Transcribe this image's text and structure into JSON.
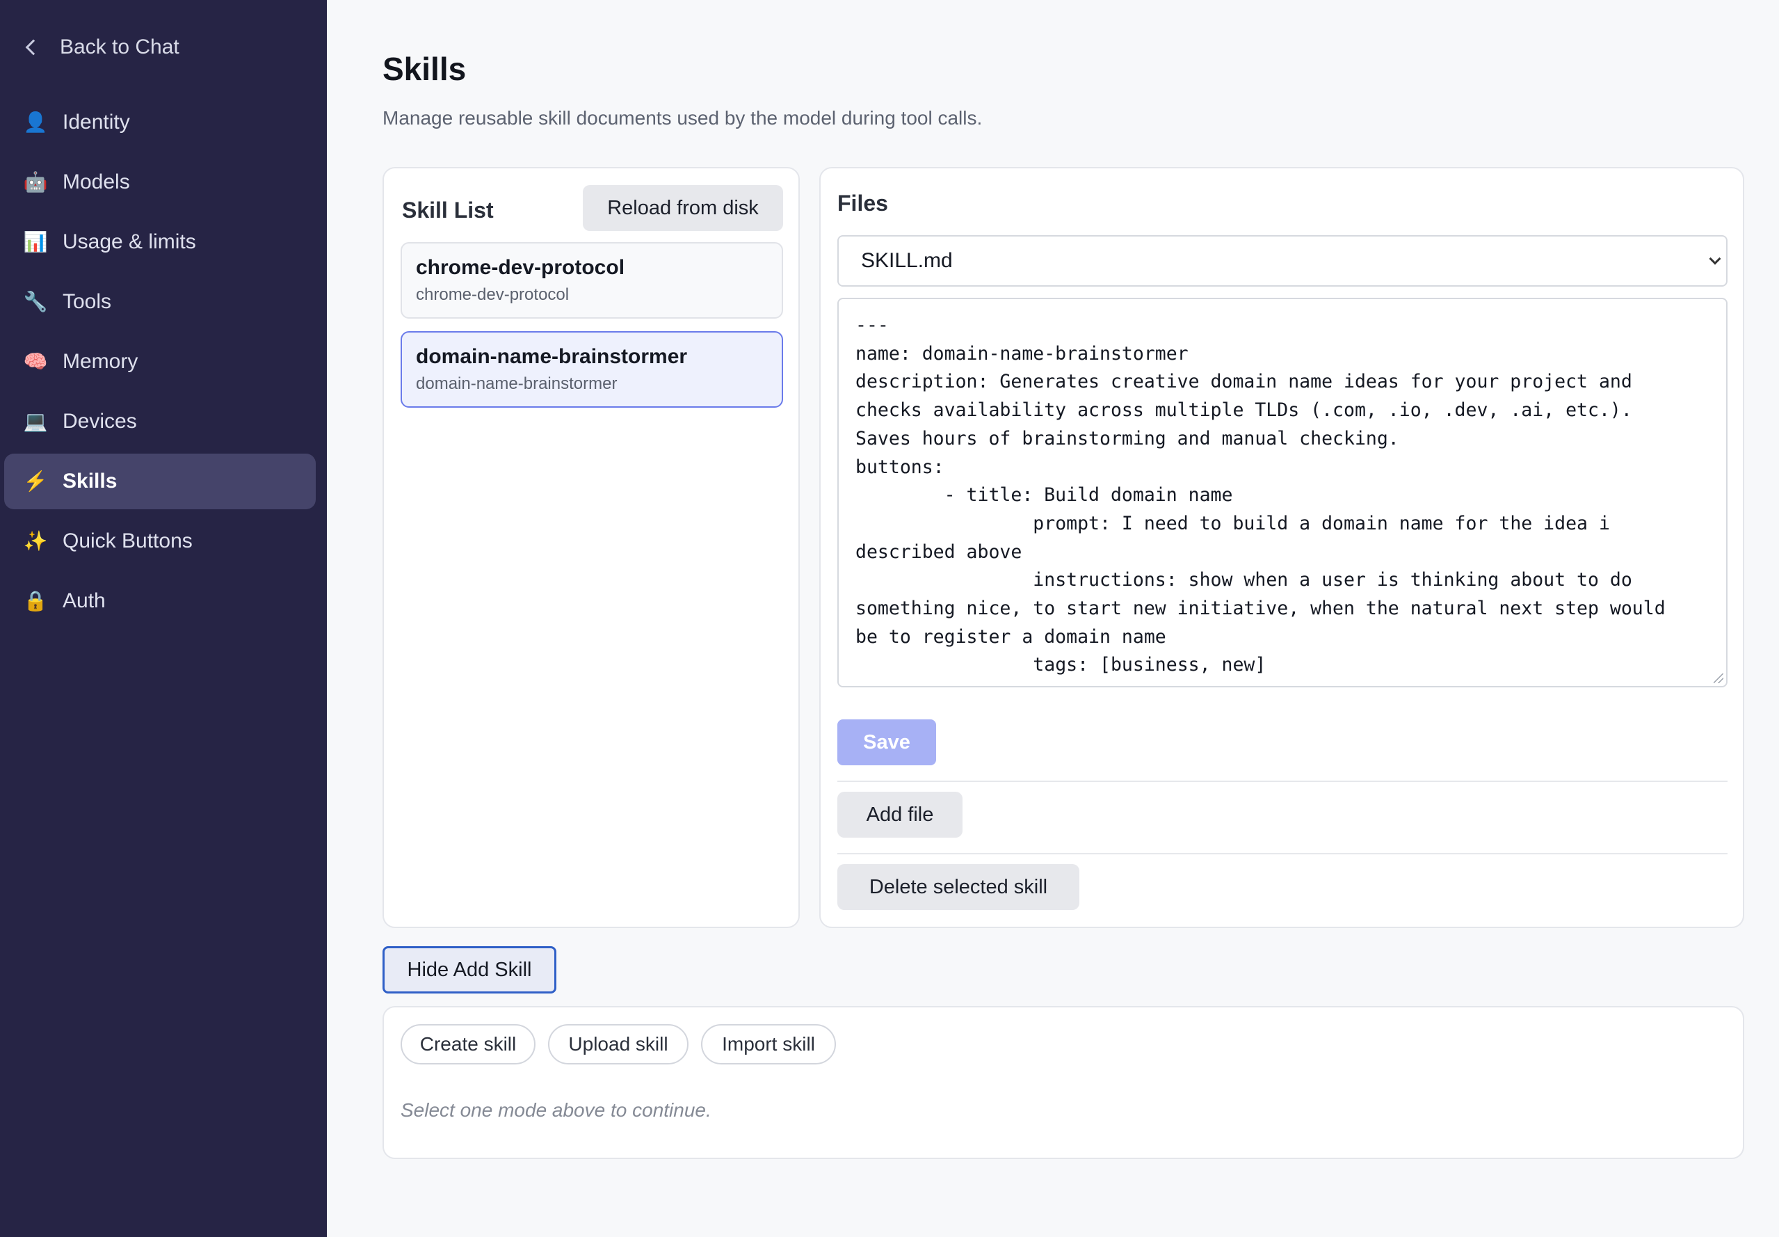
{
  "sidebar": {
    "back_label": "Back to Chat",
    "items": [
      {
        "label": "Identity",
        "icon": "👤",
        "icon_name": "person-icon"
      },
      {
        "label": "Models",
        "icon": "🤖",
        "icon_name": "robot-icon"
      },
      {
        "label": "Usage & limits",
        "icon": "📊",
        "icon_name": "bar-chart-icon"
      },
      {
        "label": "Tools",
        "icon": "🔧",
        "icon_name": "wrench-icon"
      },
      {
        "label": "Memory",
        "icon": "🧠",
        "icon_name": "brain-icon"
      },
      {
        "label": "Devices",
        "icon": "💻",
        "icon_name": "laptop-icon"
      },
      {
        "label": "Skills",
        "icon": "⚡",
        "icon_name": "lightning-icon",
        "active": true
      },
      {
        "label": "Quick Buttons",
        "icon": "✨",
        "icon_name": "sparkles-icon"
      },
      {
        "label": "Auth",
        "icon": "🔒",
        "icon_name": "lock-icon"
      }
    ]
  },
  "page": {
    "title": "Skills",
    "subtitle": "Manage reusable skill documents used by the model during tool calls."
  },
  "skill_list": {
    "title": "Skill List",
    "reload_label": "Reload from disk",
    "items": [
      {
        "name": "chrome-dev-protocol",
        "sub": "chrome-dev-protocol"
      },
      {
        "name": "domain-name-brainstormer",
        "sub": "domain-name-brainstormer",
        "selected": true
      }
    ]
  },
  "files": {
    "title": "Files",
    "selected_file": "SKILL.md",
    "content": "---\nname: domain-name-brainstormer\ndescription: Generates creative domain name ideas for your project and\nchecks availability across multiple TLDs (.com, .io, .dev, .ai, etc.).\nSaves hours of brainstorming and manual checking.\nbuttons:\n        - title: Build domain name\n                prompt: I need to build a domain name for the idea i\ndescribed above\n                instructions: show when a user is thinking about to do\nsomething nice, to start new initiative, when the natural next step would\nbe to register a domain name\n                tags: [business, new]",
    "save_label": "Save",
    "add_file_label": "Add file",
    "delete_label": "Delete selected skill"
  },
  "add_skill": {
    "toggle_label": "Hide Add Skill",
    "modes": [
      "Create skill",
      "Upload skill",
      "Import skill"
    ],
    "hint": "Select one mode above to continue."
  },
  "colors": {
    "sidebar_bg": "#262445",
    "active_item_bg": "#45446a",
    "save_button": "#a7b1f5",
    "focus_border": "#2f5fc7",
    "selected_item_border": "#6a7bea"
  }
}
